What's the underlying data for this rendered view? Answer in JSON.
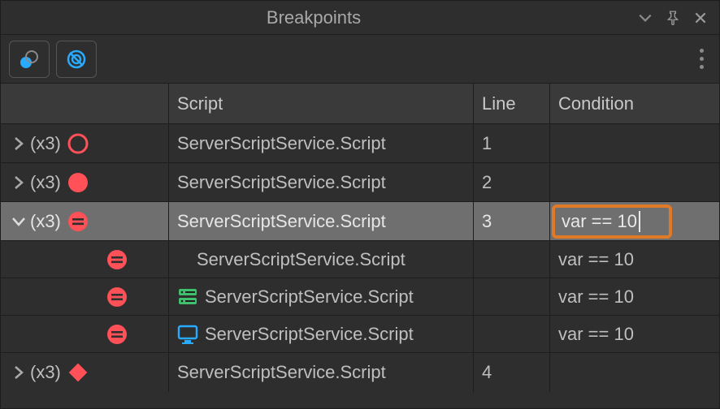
{
  "title": "Breakpoints",
  "columns": {
    "group": "",
    "script": "Script",
    "line": "Line",
    "condition": "Condition"
  },
  "icons": {
    "dropdown": "dropdown-icon",
    "pin": "pin-icon",
    "close": "close-icon",
    "bp_single": "breakpoint-single-icon",
    "bp_all": "breakpoint-all-icon",
    "kebab": "more-icon"
  },
  "colors": {
    "bp_red": "#ff5157",
    "accent_blue": "#28aaff",
    "server_green": "#3fc06c",
    "highlight_orange": "#e17a26"
  },
  "rows": [
    {
      "id": "r1",
      "type": "group",
      "expanded": false,
      "count": "(x3)",
      "bp_shape": "circle-outline",
      "script": "ServerScriptService.Script",
      "line": "1",
      "condition": ""
    },
    {
      "id": "r2",
      "type": "group",
      "expanded": false,
      "count": "(x3)",
      "bp_shape": "circle-solid",
      "script": "ServerScriptService.Script",
      "line": "2",
      "condition": ""
    },
    {
      "id": "r3",
      "type": "group",
      "expanded": true,
      "count": "(x3)",
      "bp_shape": "circle-equals",
      "script": "ServerScriptService.Script",
      "line": "3",
      "condition": "var == 10",
      "selected": true,
      "editing_condition": true
    },
    {
      "id": "r3a",
      "type": "child",
      "context": "none",
      "bp_shape": "circle-equals",
      "script": "ServerScriptService.Script",
      "line": "",
      "condition": "var == 10"
    },
    {
      "id": "r3b",
      "type": "child",
      "context": "server",
      "bp_shape": "circle-equals",
      "script": "ServerScriptService.Script",
      "line": "",
      "condition": "var == 10"
    },
    {
      "id": "r3c",
      "type": "child",
      "context": "client",
      "bp_shape": "circle-equals",
      "script": "ServerScriptService.Script",
      "line": "",
      "condition": "var == 10"
    },
    {
      "id": "r4",
      "type": "group",
      "expanded": false,
      "count": "(x3)",
      "bp_shape": "diamond-solid",
      "script": "ServerScriptService.Script",
      "line": "4",
      "condition": ""
    }
  ]
}
